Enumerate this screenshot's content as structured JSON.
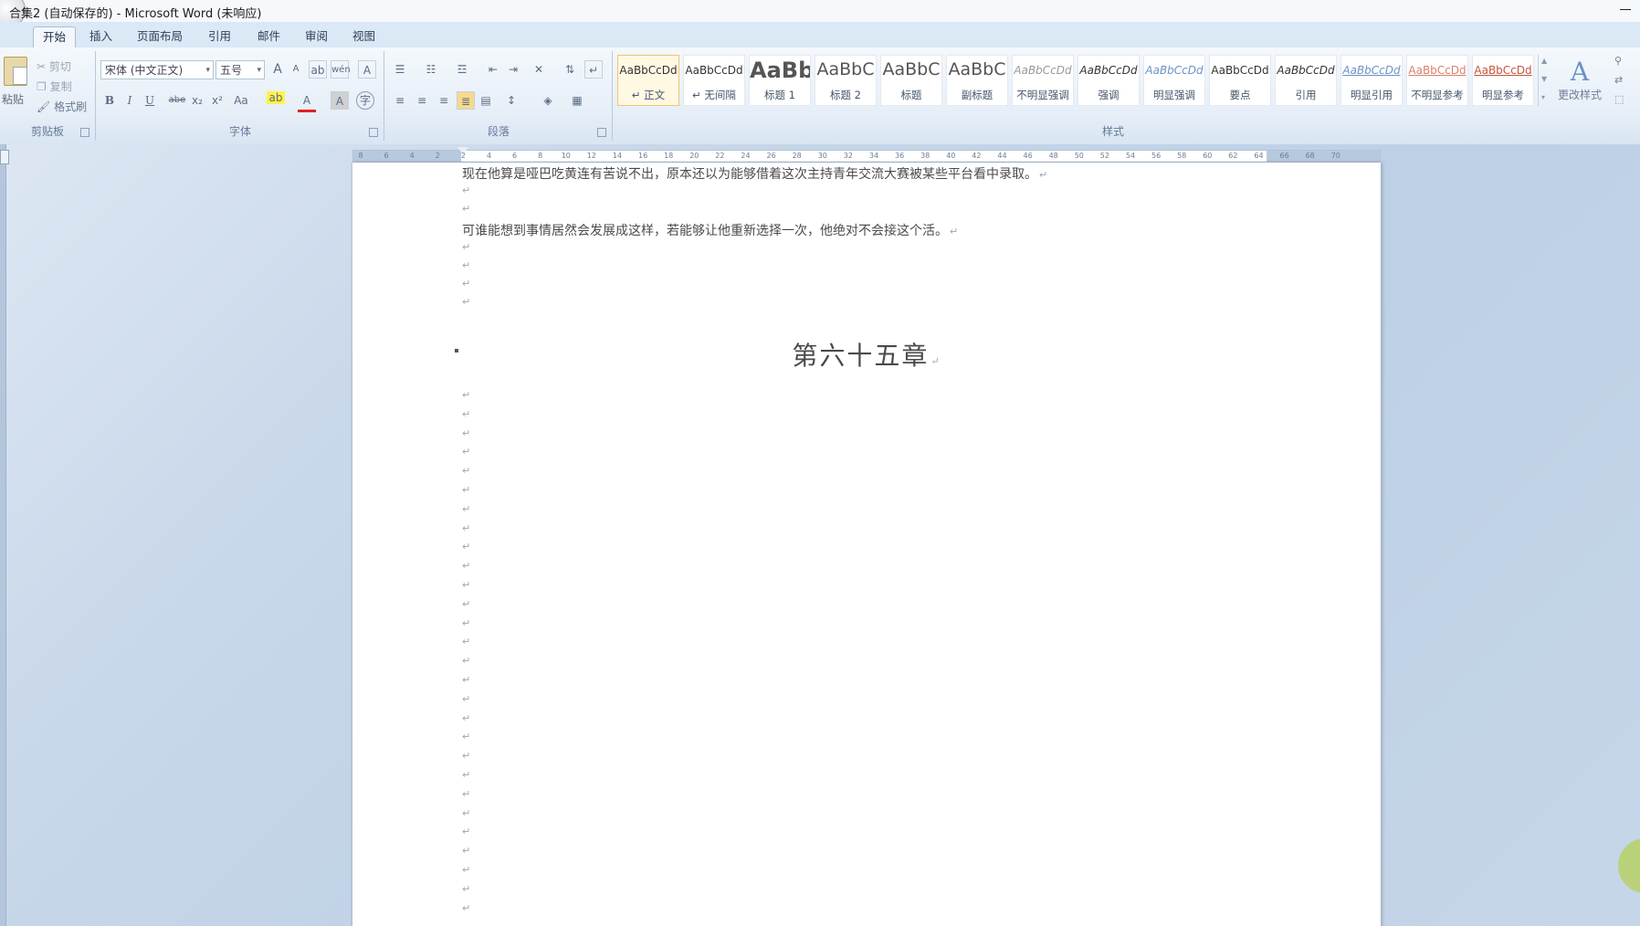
{
  "window": {
    "title": "合集2 (自动保存的) - Microsoft Word (未响应)"
  },
  "tabs": [
    "开始",
    "插入",
    "页面布局",
    "引用",
    "邮件",
    "审阅",
    "视图"
  ],
  "clipboard": {
    "paste": "粘贴",
    "cut": "剪切",
    "copy": "复制",
    "format_painter": "格式刷",
    "label": "剪贴板"
  },
  "font": {
    "name": "宋体 (中文正文)",
    "size": "五号",
    "label": "字体",
    "buttons": {
      "grow": "A",
      "shrink": "A",
      "clear": "ab",
      "phonetic": "wén",
      "border": "A",
      "bold": "B",
      "italic": "I",
      "underline": "U",
      "strike": "abe",
      "sub": "x₂",
      "sup": "x²",
      "case": "Aa",
      "highlight": "ab",
      "color": "A",
      "shade": "A",
      "enclose": "字"
    }
  },
  "paragraph": {
    "label": "段落"
  },
  "styles": {
    "label": "样式",
    "items": [
      {
        "sample": "AaBbCcDd",
        "name": "↵ 正文",
        "active": true
      },
      {
        "sample": "AaBbCcDd",
        "name": "↵ 无间隔"
      },
      {
        "sample": "AaBb",
        "name": "标题 1"
      },
      {
        "sample": "AaBbC",
        "name": "标题 2"
      },
      {
        "sample": "AaBbC",
        "name": "标题"
      },
      {
        "sample": "AaBbC",
        "name": "副标题"
      },
      {
        "sample": "AaBbCcDd",
        "name": "不明显强调"
      },
      {
        "sample": "AaBbCcDd",
        "name": "强调"
      },
      {
        "sample": "AaBbCcDd",
        "name": "明显强调"
      },
      {
        "sample": "AaBbCcDd",
        "name": "要点"
      },
      {
        "sample": "AaBbCcDd",
        "name": "引用"
      },
      {
        "sample": "AaBbCcDd",
        "name": "明显引用"
      },
      {
        "sample": "AaBbCcDd",
        "name": "不明显参考"
      },
      {
        "sample": "AaBbCcDd",
        "name": "明显参考"
      }
    ],
    "change": "更改样式"
  },
  "ruler": {
    "ticks": [
      "8",
      "6",
      "4",
      "2",
      "2",
      "4",
      "6",
      "8",
      "10",
      "12",
      "14",
      "16",
      "18",
      "20",
      "22",
      "24",
      "26",
      "28",
      "30",
      "32",
      "34",
      "36",
      "38",
      "40",
      "42",
      "44",
      "46",
      "48",
      "50",
      "52",
      "54",
      "56",
      "58",
      "60",
      "62",
      "64",
      "66",
      "68",
      "70"
    ]
  },
  "document": {
    "para1": "现在他算是哑巴吃黄连有苦说不出，原本还以为能够借着这次主持青年交流大赛被某些平台看中录取。",
    "para2": "可谁能想到事情居然会发展成这样，若能够让他重新选择一次，他绝对不会接这个活。",
    "chapter": "第六十五章",
    "return_mark": "↵"
  }
}
